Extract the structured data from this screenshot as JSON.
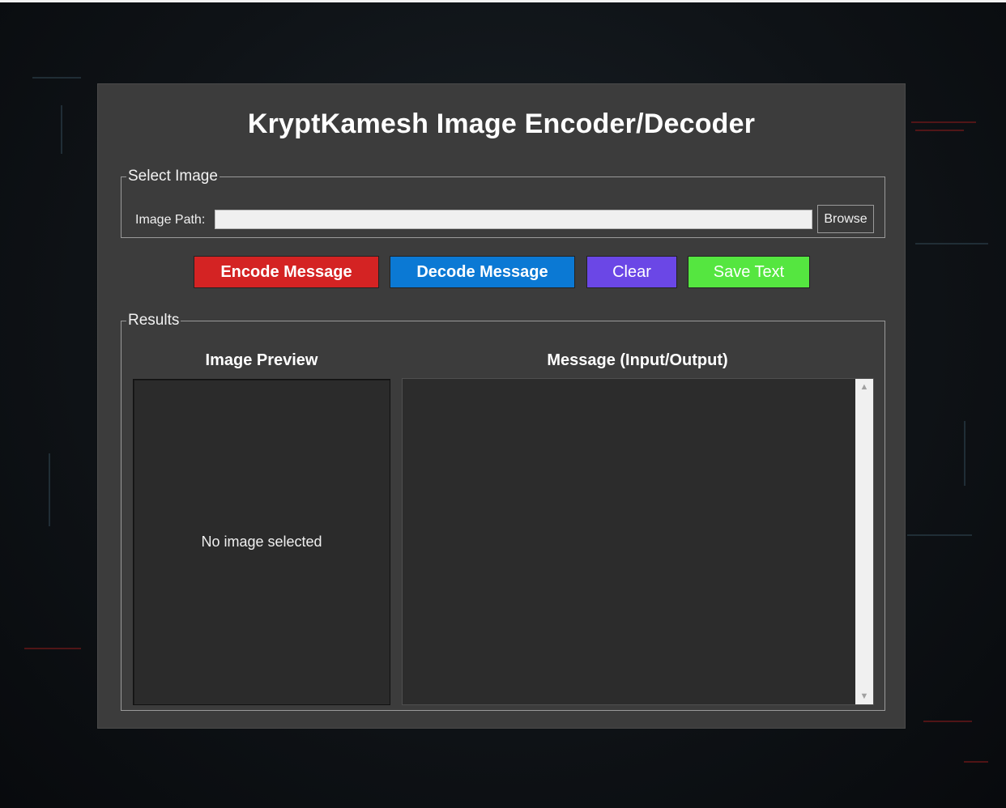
{
  "app": {
    "title": "KryptKamesh Image Encoder/Decoder"
  },
  "select_image": {
    "legend": "Select Image",
    "path_label": "Image Path:",
    "path_value": "",
    "browse_label": "Browse"
  },
  "actions": {
    "encode_label": "Encode Message",
    "decode_label": "Decode Message",
    "clear_label": "Clear",
    "save_label": "Save Text"
  },
  "results": {
    "legend": "Results",
    "preview_title": "Image Preview",
    "preview_empty": "No image selected",
    "message_title": "Message (Input/Output)",
    "message_value": ""
  },
  "icons": {
    "scroll_up": "scroll-up-arrow",
    "scroll_down": "scroll-down-arrow"
  },
  "colors": {
    "encode": "#d42323",
    "decode": "#0b79d4",
    "clear": "#6b47e6",
    "save": "#55e640",
    "panel": "#3c3c3c"
  }
}
